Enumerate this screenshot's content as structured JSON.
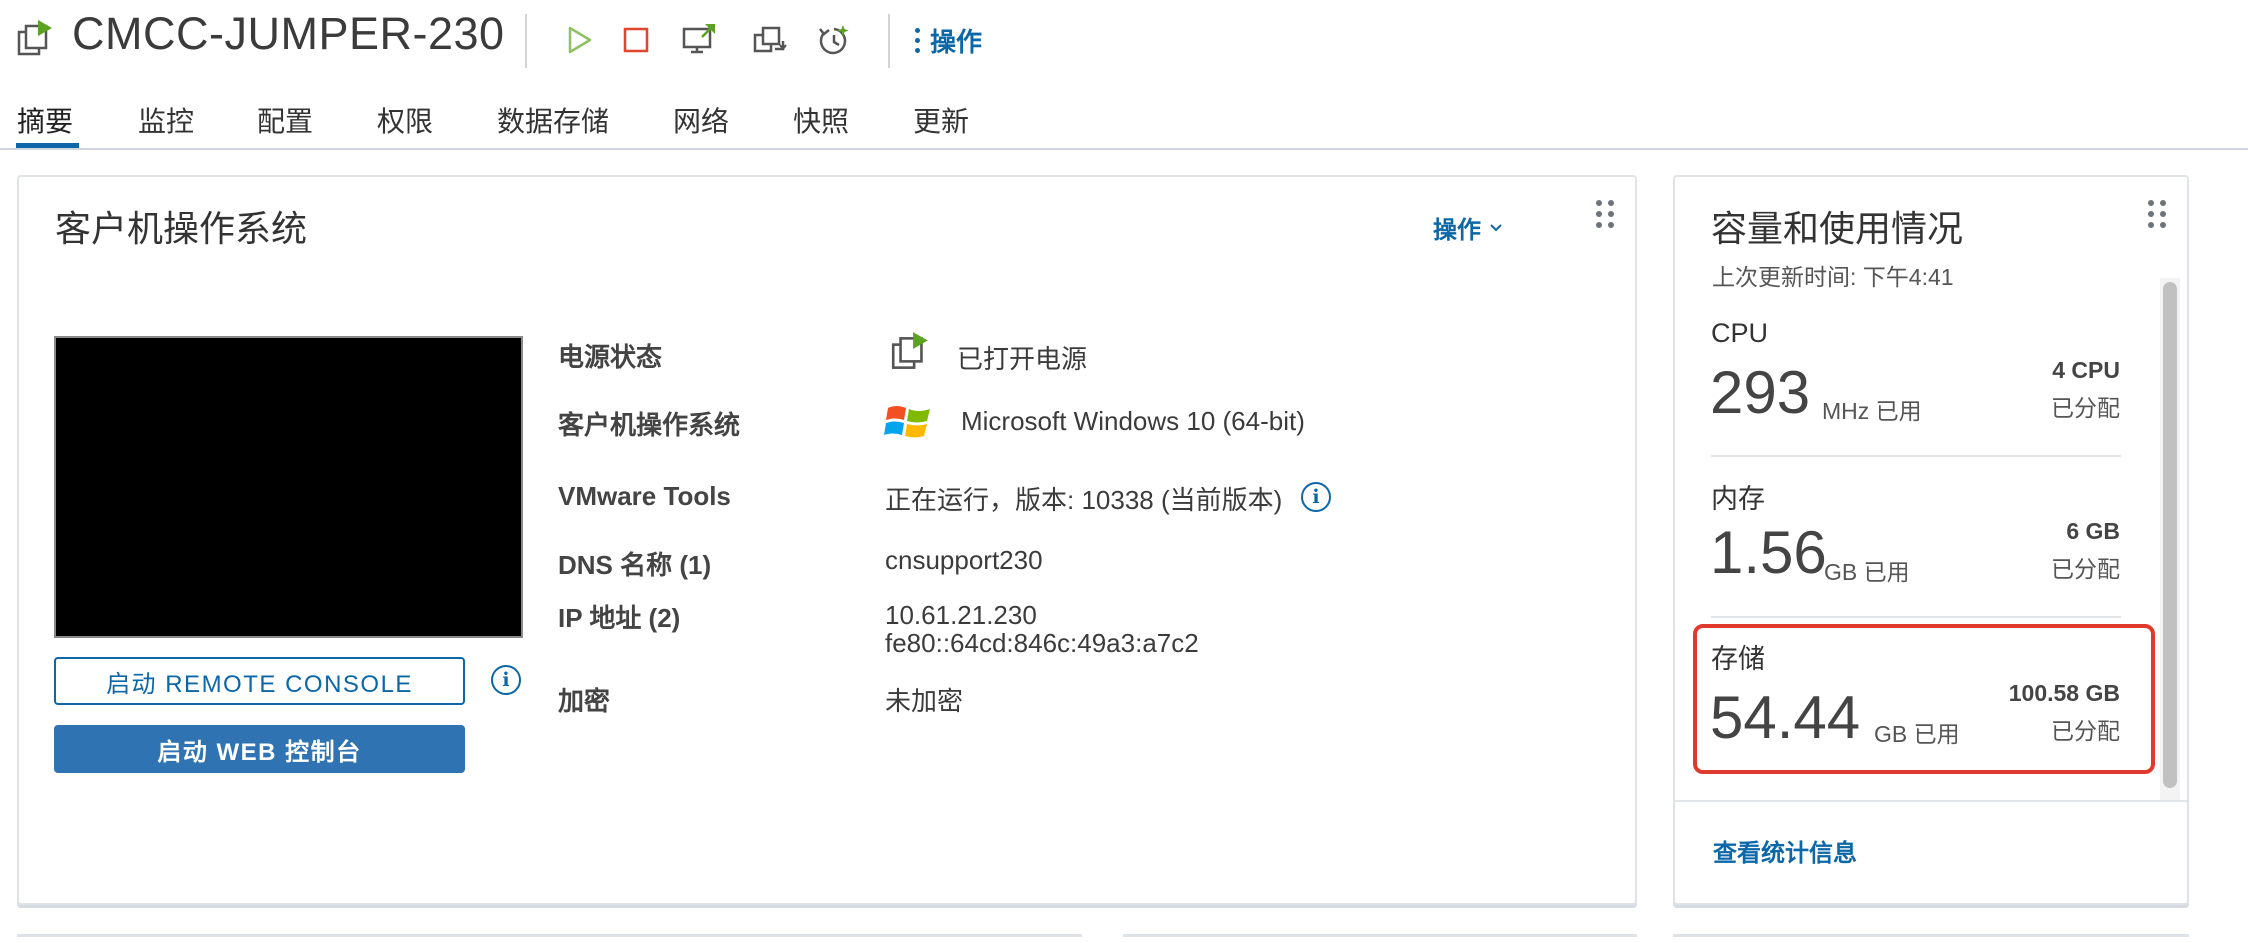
{
  "header": {
    "vm_name": "CMCC-JUMPER-230",
    "actions_label": "操作",
    "toolbar_icons": [
      "vm-powered-on-icon",
      "power-on-icon",
      "power-off-icon",
      "launch-console-icon",
      "migrate-icon",
      "snapshot-icon"
    ]
  },
  "tabs": [
    {
      "label": "摘要",
      "active": true
    },
    {
      "label": "监控"
    },
    {
      "label": "配置"
    },
    {
      "label": "权限"
    },
    {
      "label": "数据存储"
    },
    {
      "label": "网络"
    },
    {
      "label": "快照"
    },
    {
      "label": "更新"
    }
  ],
  "guest_card": {
    "title": "客户机操作系统",
    "actions_label": "操作",
    "remote_console_label": "启动 REMOTE CONSOLE",
    "web_console_label": "启动 WEB 控制台",
    "rows": [
      {
        "label": "电源状态",
        "value": "已打开电源",
        "icon": "power-on-status-icon"
      },
      {
        "label": "客户机操作系统",
        "value": "Microsoft Windows 10 (64-bit)",
        "icon": "windows-logo-icon"
      },
      {
        "label": "VMware Tools",
        "value": "正在运行，版本: 10338 (当前版本)"
      },
      {
        "label": "DNS 名称 (1)",
        "value": "cnsupport230"
      },
      {
        "label": "IP 地址 (2)",
        "value": "10.61.21.230",
        "value2": "fe80::64cd:846c:49a3:a7c2"
      },
      {
        "label": "加密",
        "value": "未加密"
      }
    ]
  },
  "capacity_card": {
    "title": "容量和使用情况",
    "updated": "上次更新时间: 下午4:41",
    "cpu": {
      "heading": "CPU",
      "used": "293",
      "unit": "MHz 已用",
      "allocated": "4 CPU",
      "allocated_label": "已分配"
    },
    "memory": {
      "heading": "内存",
      "used": "1.56",
      "unit": "GB 已用",
      "allocated": "6 GB",
      "allocated_label": "已分配"
    },
    "storage": {
      "heading": "存储",
      "used": "54.44",
      "unit": "GB 已用",
      "allocated": "100.58 GB",
      "allocated_label": "已分配"
    },
    "stats_link": "查看统计信息"
  },
  "colors": {
    "accent": "#0b67a8",
    "primary_button": "#2f73b3",
    "highlight": "#e03a2c",
    "power_green": "#5aa220",
    "power_off_red": "#e0452d"
  }
}
